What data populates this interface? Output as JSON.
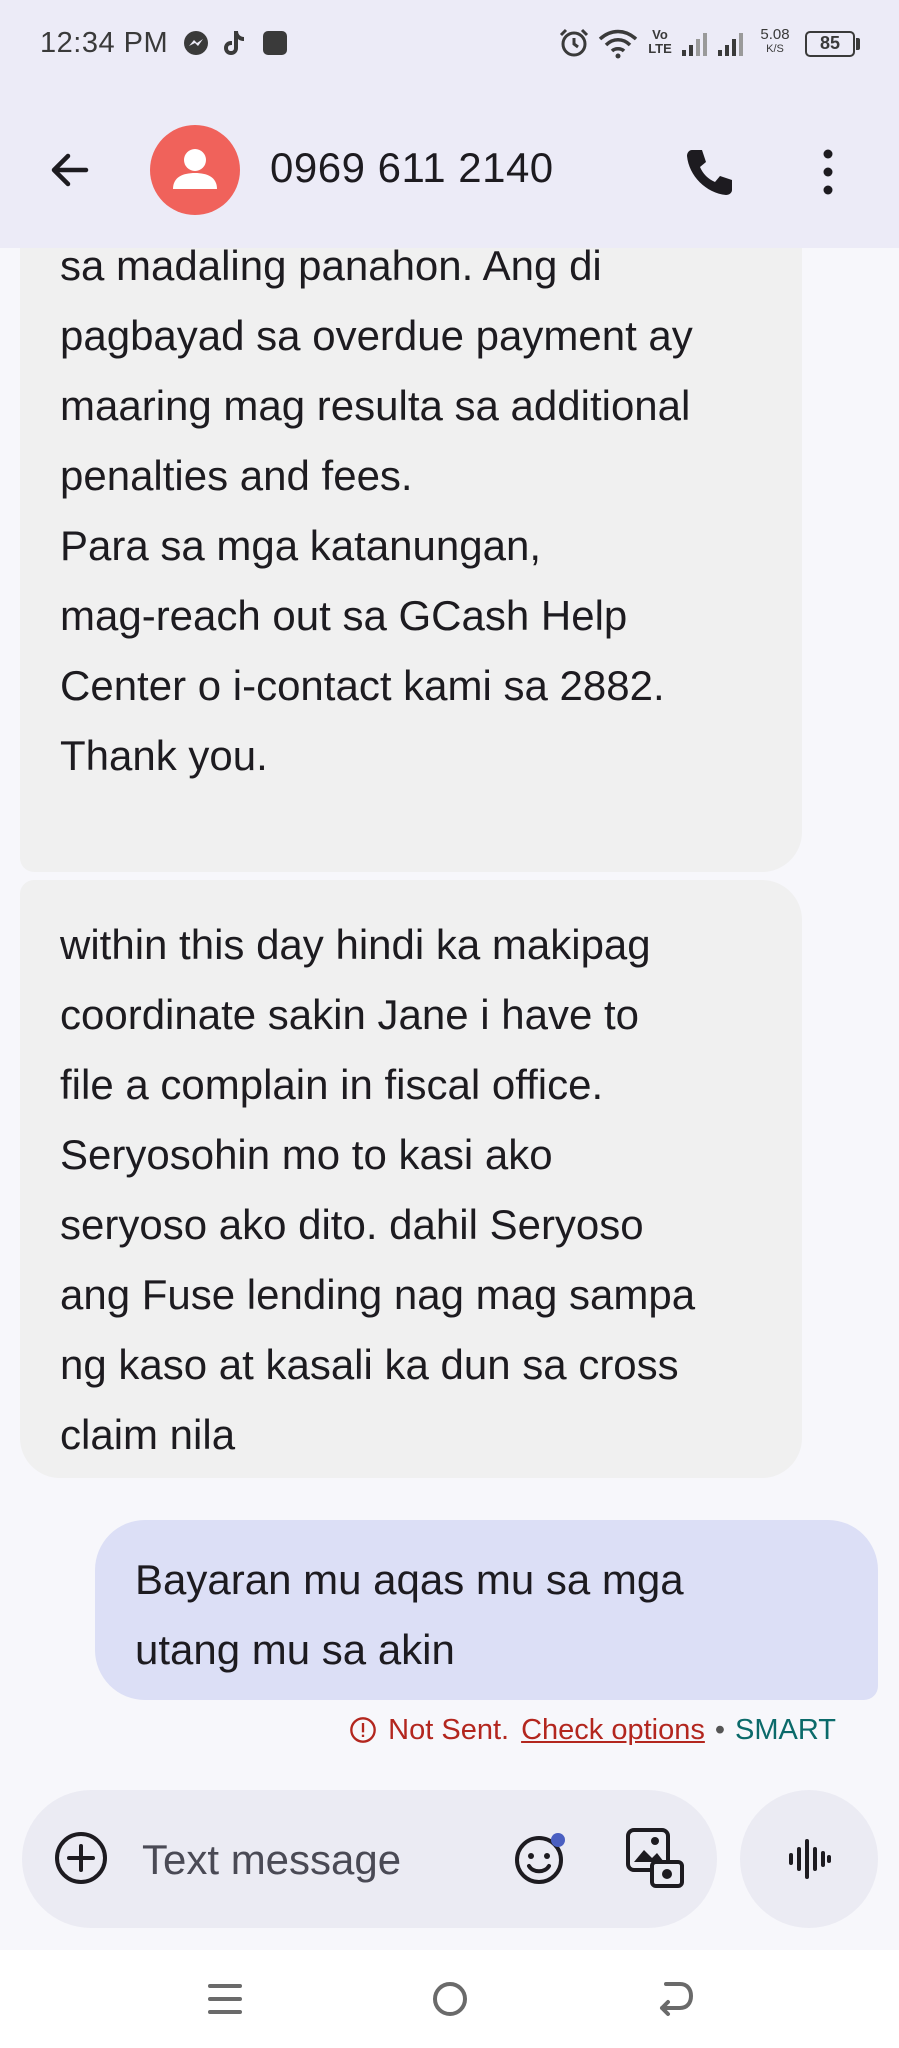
{
  "status_bar": {
    "time": "12:34 PM",
    "notification_icons": [
      "messenger-icon",
      "tiktok-icon",
      "app-icon"
    ],
    "system_icons": [
      "alarm-icon",
      "wifi-icon",
      "volte-icon",
      "signal-icon",
      "signal-icon"
    ],
    "volte_label": "Vo\nLTE",
    "speed_value": "5.08",
    "speed_unit": "K/S",
    "battery": "85"
  },
  "app_bar": {
    "contact": "0969 611 2140",
    "icons": [
      "back-arrow-icon",
      "person-icon",
      "phone-icon",
      "more-vert-icon"
    ]
  },
  "messages": [
    {
      "direction": "incoming",
      "lines": [
        "sa madaling panahon. Ang di",
        "pagbayad sa overdue payment ay",
        "maaring mag resulta sa additional",
        "penalties and fees.",
        "Para sa mga katanungan,",
        "mag-reach out sa GCash Help",
        "Center o i-contact kami sa 2882.",
        "Thank you."
      ]
    },
    {
      "direction": "incoming",
      "lines": [
        "within this day hindi ka makipag",
        "coordinate sakin Jane i have to",
        "file a complain in fiscal office.",
        "Seryosohin mo to kasi ako",
        "seryoso ako dito. dahil Seryoso",
        "ang Fuse lending nag mag sampa",
        "ng kaso at kasali ka dun sa cross",
        "claim nila"
      ]
    },
    {
      "direction": "outgoing",
      "lines": [
        "Bayaran mu aqas mu sa mga",
        "utang mu sa akin"
      ]
    }
  ],
  "send_status": {
    "error": "Not Sent.",
    "action": "Check options",
    "separator": "•",
    "carrier": "SMART"
  },
  "compose": {
    "placeholder": "Text message",
    "icons": [
      "add-circle-icon",
      "emoji-icon",
      "gallery-icon",
      "voice-wave-icon"
    ]
  },
  "nav_bar": {
    "icons": [
      "menu-icon",
      "home-icon",
      "back-icon"
    ]
  },
  "colors": {
    "header_bg": "#ecebf7",
    "incoming_bubble": "#f0f0f0",
    "outgoing_bubble": "#dcdff6",
    "avatar": "#f0625b",
    "error": "#b3261e",
    "carrier": "#0b6a6a"
  }
}
